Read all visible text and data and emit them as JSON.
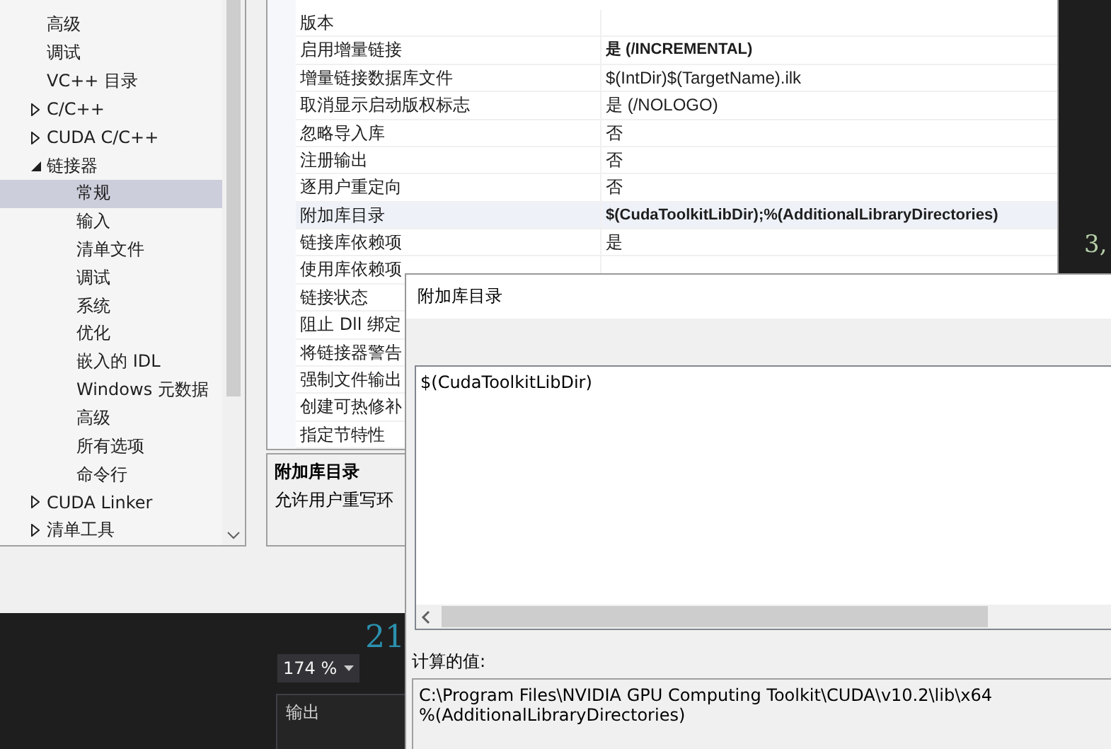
{
  "sidebar": {
    "items": [
      {
        "label": "高级",
        "selected": false
      },
      {
        "label": "调试",
        "selected": false
      },
      {
        "label": "VC++ 目录",
        "selected": false
      },
      {
        "label": "C/C++",
        "expanded": false,
        "selected": false
      },
      {
        "label": "CUDA C/C++",
        "expanded": false,
        "selected": false
      },
      {
        "label": "链接器",
        "expanded": true,
        "selected": false,
        "children": [
          {
            "label": "常规",
            "selected": true
          },
          {
            "label": "输入",
            "selected": false
          },
          {
            "label": "清单文件",
            "selected": false
          },
          {
            "label": "调试",
            "selected": false
          },
          {
            "label": "系统",
            "selected": false
          },
          {
            "label": "优化",
            "selected": false
          },
          {
            "label": "嵌入的 IDL",
            "selected": false
          },
          {
            "label": "Windows 元数据",
            "selected": false
          },
          {
            "label": "高级",
            "selected": false
          },
          {
            "label": "所有选项",
            "selected": false
          },
          {
            "label": "命令行",
            "selected": false
          }
        ]
      },
      {
        "label": "CUDA Linker",
        "expanded": false,
        "selected": false
      },
      {
        "label": "清单工具",
        "expanded": false,
        "selected": false
      }
    ]
  },
  "properties": {
    "rows": [
      {
        "name": "版本",
        "selected": false
      },
      {
        "name": "启用增量链接",
        "value": "是 (/INCREMENTAL)",
        "bold": true,
        "selected": false
      },
      {
        "name": "增量链接数据库文件",
        "value": "$(IntDir)$(TargetName).ilk",
        "bold": false,
        "selected": false
      },
      {
        "name": "取消显示启动版权标志",
        "value": "是 (/NOLOGO)",
        "bold": false,
        "selected": false
      },
      {
        "name": "忽略导入库",
        "value": "否",
        "bold": false,
        "selected": false
      },
      {
        "name": "注册输出",
        "value": "否",
        "bold": false,
        "selected": false
      },
      {
        "name": "逐用户重定向",
        "value": "否",
        "bold": false,
        "selected": false
      },
      {
        "name": "附加库目录",
        "value": "$(CudaToolkitLibDir);%(AdditionalLibraryDirectories)",
        "bold": true,
        "selected": true
      },
      {
        "name": "链接库依赖项",
        "value": "是",
        "bold": false,
        "selected": false
      },
      {
        "name": "使用库依赖项",
        "selected": false
      },
      {
        "name": "链接状态",
        "selected": false
      },
      {
        "name": "阻止 Dll 绑定",
        "selected": false
      },
      {
        "name": "将链接器警告",
        "selected": false
      },
      {
        "name": "强制文件输出",
        "selected": false
      },
      {
        "name": "创建可热修补",
        "selected": false
      },
      {
        "name": "指定节特性",
        "selected": false
      }
    ]
  },
  "description": {
    "title": "附加库目录",
    "text": "允许用户重写环"
  },
  "editor": {
    "code_fragment": "3,",
    "line_number": "21",
    "zoom": "174 %",
    "output_title": "输出"
  },
  "dialog": {
    "title": "附加库目录",
    "value": "$(CudaToolkitLibDir)",
    "computed_label": "计算的值:",
    "computed_lines": [
      "C:\\Program Files\\NVIDIA GPU Computing Toolkit\\CUDA\\v10.2\\lib\\x64",
      "%(AdditionalLibraryDirectories)"
    ]
  }
}
